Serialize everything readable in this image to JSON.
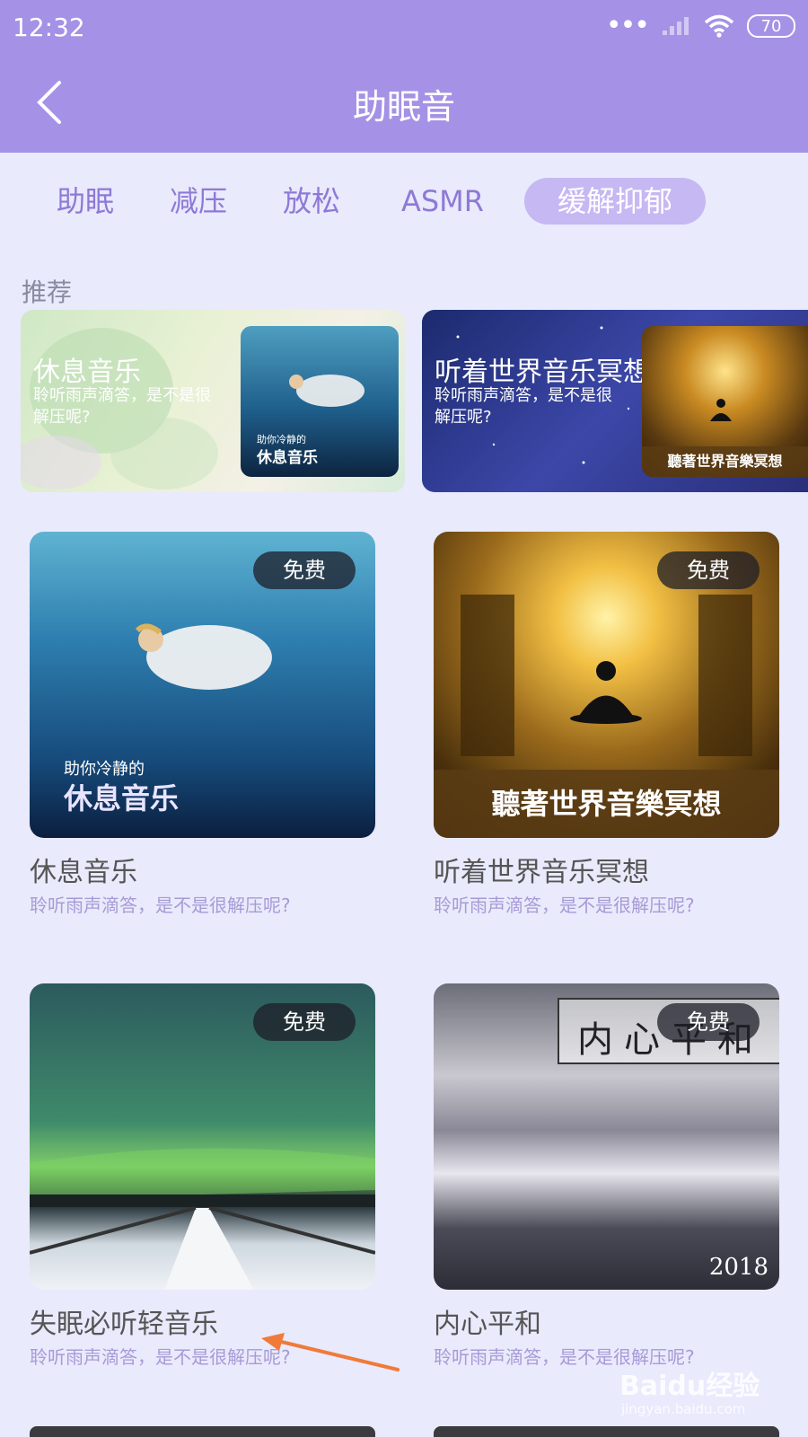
{
  "status_bar": {
    "time": "12:32",
    "battery": "70"
  },
  "header": {
    "title": "助眠音"
  },
  "tabs": [
    {
      "label": "助眠",
      "active": false
    },
    {
      "label": "减压",
      "active": false
    },
    {
      "label": "放松",
      "active": false
    },
    {
      "label": "ASMR",
      "active": false
    },
    {
      "label": "缓解抑郁",
      "active": true
    }
  ],
  "section": {
    "label": "推荐"
  },
  "banners": [
    {
      "title": "休息音乐",
      "subtitle": "聆听雨声滴答，是不是很解压呢?",
      "thumb_small": "助你冷静的",
      "thumb_big": "休息音乐"
    },
    {
      "title": "听着世界音乐冥想",
      "subtitle": "聆听雨声滴答，是不是很解压呢?",
      "thumb_caption": "聽著世界音樂冥想"
    }
  ],
  "cards": [
    {
      "title": "休息音乐",
      "desc": "聆听雨声滴答，是不是很解压呢?",
      "badge": "免费",
      "overlay_small": "助你冷静的",
      "overlay_big": "休息音乐"
    },
    {
      "title": "听着世界音乐冥想",
      "desc": "聆听雨声滴答，是不是很解压呢?",
      "badge": "免费",
      "overlay_caption": "聽著世界音樂冥想"
    },
    {
      "title": "失眠必听轻音乐",
      "desc": "聆听雨声滴答，是不是很解压呢?",
      "badge": "免费"
    },
    {
      "title": "内心平和",
      "desc": "聆听雨声滴答，是不是很解压呢?",
      "badge": "免费",
      "overlay_caption": "内心平和",
      "overlay_year": "2018"
    }
  ],
  "watermark": {
    "brand": "Baidu经验",
    "url": "jingyan.baidu.com"
  },
  "colors": {
    "header": "#a592e6",
    "background": "#e9eafc",
    "accent": "#8f79d6",
    "active_tab": "#c6b8f2",
    "desc": "#a89ad6",
    "annotation_arrow": "#f07a3a"
  }
}
